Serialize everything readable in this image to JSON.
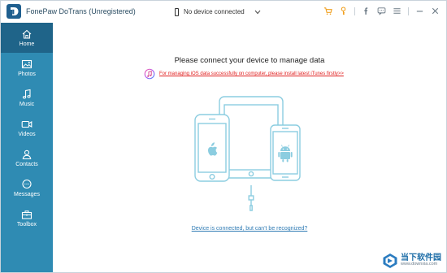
{
  "app": {
    "title": "FonePaw DoTrans (Unregistered)",
    "brand_color": "#2f8bb3",
    "sidebar_active_color": "#1f6489",
    "accent_orange": "#f0a020"
  },
  "device": {
    "status": "No device connected"
  },
  "toolbar": {
    "icons": [
      "cart-icon",
      "key-icon",
      "facebook-icon",
      "feedback-icon",
      "menu-icon",
      "minimize-icon",
      "close-icon"
    ]
  },
  "sidebar": {
    "items": [
      {
        "label": "Home",
        "icon": "home-icon",
        "active": true
      },
      {
        "label": "Photos",
        "icon": "photos-icon",
        "active": false
      },
      {
        "label": "Music",
        "icon": "music-icon",
        "active": false
      },
      {
        "label": "Videos",
        "icon": "videos-icon",
        "active": false
      },
      {
        "label": "Contacts",
        "icon": "contacts-icon",
        "active": false
      },
      {
        "label": "Messages",
        "icon": "messages-icon",
        "active": false
      },
      {
        "label": "Toolbox",
        "icon": "toolbox-icon",
        "active": false
      }
    ]
  },
  "main": {
    "title": "Please connect your device to manage data",
    "itunes_notice": "For managing iOS data successfully on computer, please install latest iTunes firstly>>",
    "recognize_link": "Device is connected, but can't be recognized?"
  },
  "watermark": {
    "name": "当下软件园",
    "url": "www.downxia.com"
  }
}
